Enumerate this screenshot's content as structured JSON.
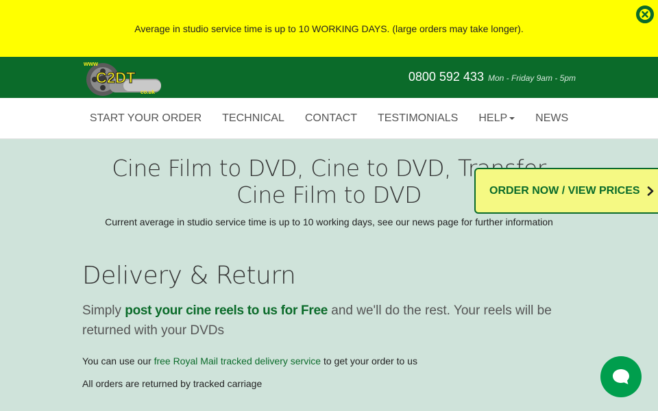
{
  "notice": {
    "text": "Average in studio service time is up to 10 WORKING DAYS. (large orders may take longer)."
  },
  "header": {
    "logo_www": "www",
    "logo_main": "C2DT",
    "logo_suffix": "co.uk",
    "phone": "0800 592 433",
    "hours": "Mon - Friday 9am - 5pm"
  },
  "nav": {
    "items": [
      {
        "label": "START YOUR ORDER"
      },
      {
        "label": "TECHNICAL"
      },
      {
        "label": "CONTACT"
      },
      {
        "label": "TESTIMONIALS"
      },
      {
        "label": "HELP"
      },
      {
        "label": "NEWS"
      }
    ]
  },
  "main": {
    "title_line1": "Cine Film to DVD, Cine to DVD, Transfer",
    "title_line2": "Cine Film to DVD",
    "service_note": "Current average in studio service time is up to 10 working days, see our news page for further information",
    "order_button": "ORDER NOW / VIEW PRICES",
    "section_title": "Delivery & Return",
    "lead_pre": "Simply ",
    "lead_link": "post your cine reels to us for Free",
    "lead_post": " and we'll do the rest. Your reels will be returned with your DVDs",
    "p1_pre": "You can use our ",
    "p1_link": "free Royal Mail tracked delivery service",
    "p1_post": " to get your order to us",
    "p2": "All orders are returned by tracked carriage"
  },
  "colors": {
    "notice_bg": "#ffff00",
    "brand_green": "#0b6b2a",
    "page_bg": "#cfe3da",
    "order_bg": "#f5f983",
    "chat_green": "#009e4d"
  },
  "icons": {
    "close": "close-circle-icon",
    "chevron": "chevron-right-icon",
    "chat": "chat-bubble-icon"
  }
}
